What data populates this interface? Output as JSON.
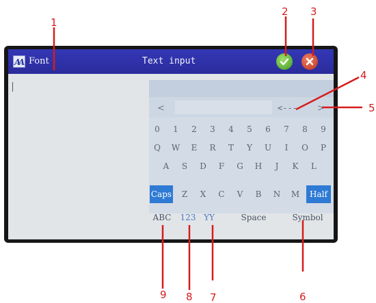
{
  "titlebar": {
    "font_label": "Font",
    "title": "Text input"
  },
  "candidate_bar": {
    "prev": "<",
    "backspace": "<---",
    "next": ">"
  },
  "keyboard": {
    "row1": [
      "0",
      "1",
      "2",
      "3",
      "4",
      "5",
      "6",
      "7",
      "8",
      "9"
    ],
    "row2": [
      "Q",
      "W",
      "E",
      "R",
      "T",
      "Y",
      "U",
      "I",
      "O",
      "P"
    ],
    "row3": [
      "A",
      "S",
      "D",
      "F",
      "G",
      "H",
      "J",
      "K",
      "L"
    ],
    "row4": {
      "caps": "Caps",
      "keys": [
        "Z",
        "X",
        "C",
        "V",
        "B",
        "N",
        "M"
      ],
      "half": "Half"
    },
    "row5": {
      "abc": "ABC",
      "num": "123",
      "yy": "YY",
      "space": "Space",
      "symbol": "Symbol"
    }
  },
  "callouts": [
    "1",
    "2",
    "3",
    "4",
    "5",
    "6",
    "7",
    "8",
    "9"
  ],
  "colors": {
    "titlebar": "#2f32ad",
    "accent": "#2e7ad4",
    "callout": "#d61c1c",
    "ok": "#4caf2a",
    "close": "#c8432a"
  }
}
